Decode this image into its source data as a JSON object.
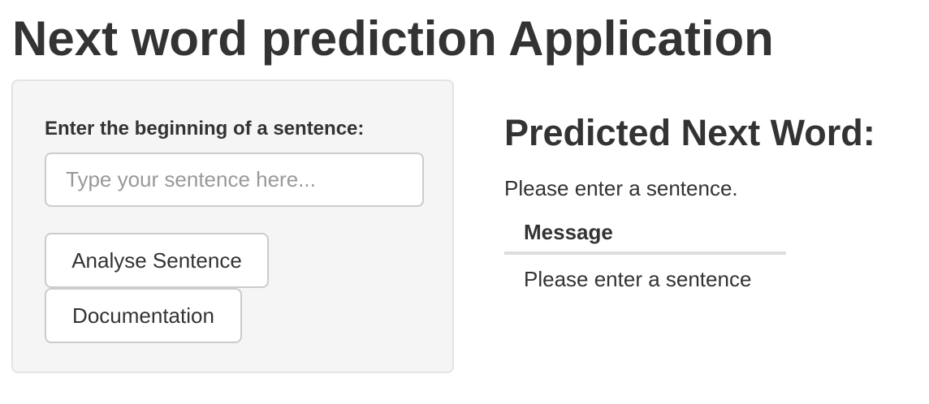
{
  "app": {
    "title": "Next word prediction Application"
  },
  "sidebar": {
    "input_label": "Enter the beginning of a sentence:",
    "input_value": "",
    "input_placeholder": "Type your sentence here...",
    "analyse_button_label": "Analyse Sentence",
    "documentation_button_label": "Documentation"
  },
  "main": {
    "heading": "Predicted Next Word:",
    "status_text": "Please enter a sentence.",
    "table": {
      "columns": [
        "Message"
      ],
      "rows": [
        [
          "Please enter a sentence"
        ]
      ]
    }
  },
  "colors": {
    "text": "#333333",
    "panel_background": "#f5f5f5",
    "panel_border": "#e3e3e3",
    "input_border": "#cccccc",
    "placeholder": "#999999",
    "table_rule": "#dddddd"
  }
}
